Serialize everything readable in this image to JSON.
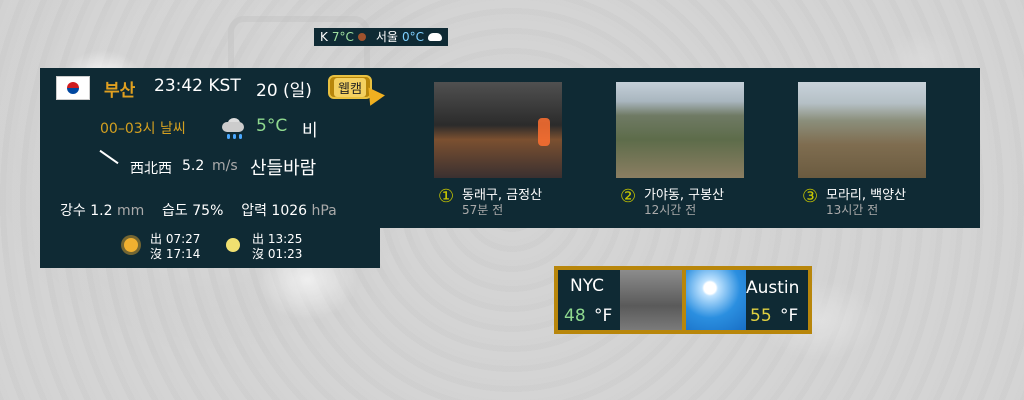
{
  "topbar": {
    "k_label": "K",
    "k_temp": "7°C",
    "seoul_label": "서울",
    "seoul_temp": "0°C"
  },
  "main": {
    "city": "부산",
    "time": "23:42 KST",
    "date": "20 (일)",
    "webcam_label": "웹캠",
    "hour_range": "00–03시 날씨",
    "temp": "5°C",
    "condition": "비",
    "wind_dir": "西北西",
    "wind_speed": "5.2",
    "wind_unit": "m/s",
    "wind_name": "산들바람",
    "precip_label": "강수",
    "precip_value": "1.2",
    "precip_unit": "mm",
    "humidity_label": "습도",
    "humidity_value": "75%",
    "pressure_label": "압력",
    "pressure_value": "1026",
    "pressure_unit": "hPa",
    "sunrise": "出 07:27",
    "sunset": "沒 17:14",
    "moonrise": "出 13:25",
    "moonset": "沒 01:23"
  },
  "webcams": [
    {
      "num": "①",
      "title": "동래구, 금정산",
      "ago": "57분 전"
    },
    {
      "num": "②",
      "title": "가야동, 구봉산",
      "ago": "12시간 전"
    },
    {
      "num": "③",
      "title": "모라리, 백양산",
      "ago": "13시간 전"
    }
  ],
  "cities": {
    "nyc": {
      "name": "NYC",
      "temp": "48",
      "unit": "°F"
    },
    "austin": {
      "name": "Austin",
      "temp": "55",
      "unit": "°F"
    }
  }
}
